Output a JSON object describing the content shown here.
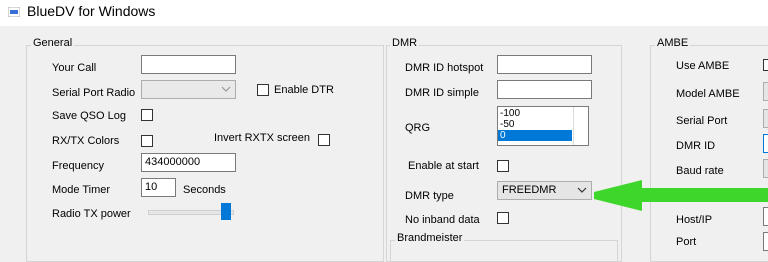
{
  "window": {
    "title": "BlueDV for Windows",
    "app_icon": "bluedv-app-icon"
  },
  "general": {
    "title": "General",
    "your_call_label": "Your Call",
    "your_call_value": "",
    "serial_port_label": "Serial Port Radio",
    "serial_port_value": "",
    "enable_dtr_label": "Enable DTR",
    "save_qso_label": "Save QSO Log",
    "rxtx_colors_label": "RX/TX Colors",
    "invert_rxtx_label": "Invert RXTX screen",
    "frequency_label": "Frequency",
    "frequency_value": "434000000",
    "mode_timer_label": "Mode Timer",
    "mode_timer_value": "10",
    "seconds_label": "Seconds",
    "radio_tx_power_label": "Radio TX power",
    "radio_tx_power_level": 1.0
  },
  "dmr": {
    "title": "DMR",
    "dmr_id_hotspot_label": "DMR ID hotspot",
    "dmr_id_hotspot_value": "",
    "dmr_id_simple_label": "DMR ID simple",
    "dmr_id_simple_value": "",
    "qrg_label": "QRG",
    "qrg_options": [
      "-100",
      "-50",
      "0"
    ],
    "qrg_selected": "0",
    "enable_at_start_label": "Enable at start",
    "dmr_type_label": "DMR type",
    "dmr_type_value": "FREEDMR",
    "no_inband_label": "No inband data",
    "brandmeister_title": "Brandmeister"
  },
  "ambe": {
    "title": "AMBE",
    "use_ambe_label": "Use AMBE",
    "model_ambe_label": "Model AMBE",
    "serial_port_label": "Serial Port",
    "dmr_id_label": "DMR ID",
    "baud_rate_label": "Baud rate",
    "host_ip_label": "Host/IP",
    "port_label": "Port"
  },
  "annotation": {
    "arrow_color": "#3ed62b",
    "arrow_icon": "green-arrow-pointer"
  }
}
